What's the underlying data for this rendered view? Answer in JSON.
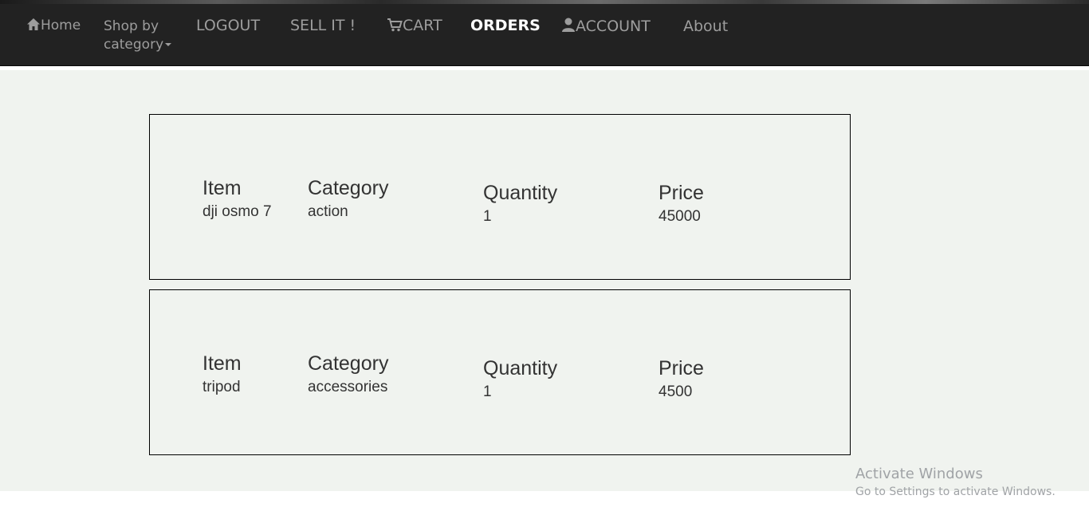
{
  "nav": {
    "home": "Home",
    "shop_line1": "Shop by",
    "shop_line2": "category",
    "logout": "LOGOUT",
    "sell": "SELL IT !",
    "cart": "CART",
    "orders": "ORDERS",
    "account": "ACCOUNT",
    "about": "About"
  },
  "headers": {
    "item": "Item",
    "category": "Category",
    "quantity": "Quantity",
    "price": "Price"
  },
  "orders": [
    {
      "item": "dji osmo 7",
      "category": "action",
      "quantity": "1",
      "price": "45000"
    },
    {
      "item": "tripod",
      "category": "accessories",
      "quantity": "1",
      "price": "4500"
    }
  ],
  "watermark": {
    "title": "Activate Windows",
    "subtitle": "Go to Settings to activate Windows."
  },
  "icons": {
    "home": "home-icon",
    "cart": "shopping-cart-icon",
    "account": "user-icon",
    "dropdown": "caret-down-icon"
  }
}
